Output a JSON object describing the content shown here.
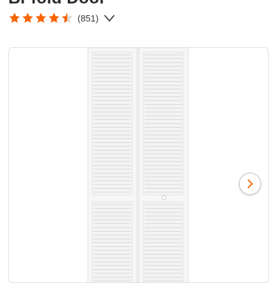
{
  "product": {
    "title": "Bi-fold Door",
    "rating": {
      "value": 4.5,
      "max": 5,
      "count_label": "(851)"
    }
  },
  "icons": {
    "star": "star-icon",
    "expand": "chevron-down-icon",
    "next": "chevron-right-icon"
  },
  "colors": {
    "star_fill": "#f96302",
    "star_empty": "#d9d9d9",
    "next_arrow": "#f96302"
  }
}
